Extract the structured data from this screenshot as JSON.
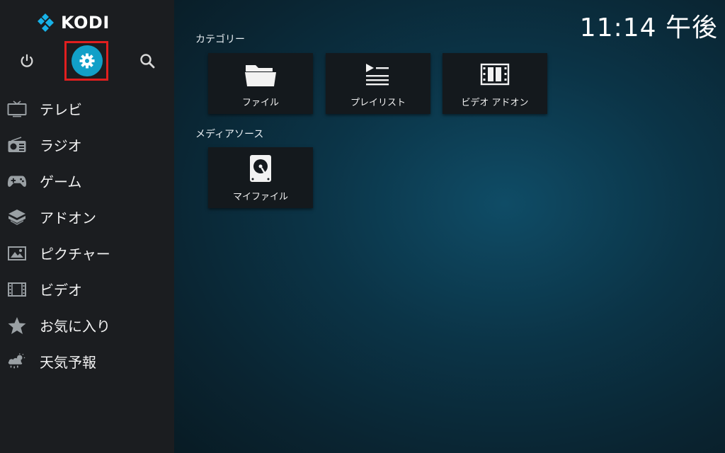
{
  "app": {
    "name": "KODI"
  },
  "clock": "11:14 午後",
  "top_buttons": {
    "power_icon": "power-icon",
    "settings_icon": "gear-icon",
    "search_icon": "search-icon"
  },
  "sidebar": {
    "items": [
      {
        "label": "テレビ",
        "icon": "tv-icon"
      },
      {
        "label": "ラジオ",
        "icon": "radio-icon"
      },
      {
        "label": "ゲーム",
        "icon": "gamepad-icon"
      },
      {
        "label": "アドオン",
        "icon": "addon-box-icon"
      },
      {
        "label": "ピクチャー",
        "icon": "picture-icon"
      },
      {
        "label": "ビデオ",
        "icon": "film-icon"
      },
      {
        "label": "お気に入り",
        "icon": "star-icon"
      },
      {
        "label": "天気予報",
        "icon": "weather-icon"
      }
    ]
  },
  "main": {
    "categories_title": "カテゴリー",
    "categories": [
      {
        "label": "ファイル",
        "icon": "folder-icon"
      },
      {
        "label": "プレイリスト",
        "icon": "playlist-icon"
      },
      {
        "label": "ビデオ アドオン",
        "icon": "film-strip-icon"
      }
    ],
    "media_sources_title": "メディアソース",
    "media_sources": [
      {
        "label": "マイファイル",
        "icon": "hard-drive-icon"
      }
    ]
  },
  "colors": {
    "accent": "#12a0c8",
    "highlight": "#e01f1f",
    "sidebar_bg": "#1b1d20",
    "tile_bg": "#14191d"
  }
}
